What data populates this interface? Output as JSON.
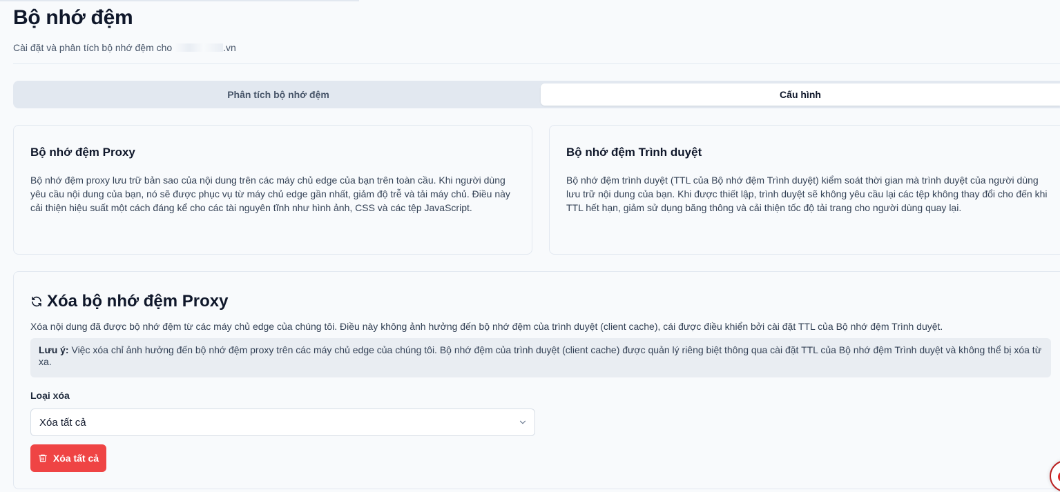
{
  "header": {
    "title": "Bộ nhớ đệm",
    "subtitle_prefix": "Cài đặt và phân tích bộ nhớ đệm cho ",
    "subtitle_domain_suffix": ".vn"
  },
  "tabs": [
    {
      "label": "Phân tích bộ nhớ đệm",
      "active": false
    },
    {
      "label": "Cấu hình",
      "active": true
    }
  ],
  "cards": {
    "proxy": {
      "title": "Bộ nhớ đệm Proxy",
      "body": "Bộ nhớ đệm proxy lưu trữ bản sao của nội dung trên các máy chủ edge của bạn trên toàn cầu. Khi người dùng yêu cầu nội dung của bạn, nó sẽ được phục vụ từ máy chủ edge gần nhất, giảm độ trễ và tải máy chủ. Điều này cải thiện hiệu suất một cách đáng kể cho các tài nguyên tĩnh như hình ảnh, CSS và các tệp JavaScript."
    },
    "browser": {
      "title": "Bộ nhớ đệm Trình duyệt",
      "body": "Bộ nhớ đệm trình duyệt (TTL của Bộ nhớ đệm Trình duyệt) kiểm soát thời gian mà trình duyệt của người dùng lưu trữ nội dung của bạn. Khi được thiết lập, trình duyệt sẽ không yêu cầu lại các tệp không thay đổi cho đến khi TTL hết hạn, giảm sử dụng băng thông và cải thiện tốc độ tải trang cho người dùng quay lại."
    }
  },
  "purge": {
    "title": "Xóa bộ nhớ đệm Proxy",
    "description": "Xóa nội dung đã được bộ nhớ đệm từ các máy chủ edge của chúng tôi. Điều này không ảnh hưởng đến bộ nhớ đệm của trình duyệt (client cache), cái được điều khiển bởi cài đặt TTL của Bộ nhớ đệm Trình duyệt.",
    "note_label": "Lưu ý:",
    "note_text": " Việc xóa chỉ ảnh hưởng đến bộ nhớ đệm proxy trên các máy chủ edge của chúng tôi. Bộ nhớ đệm của trình duyệt (client cache) được quản lý riêng biệt thông qua cài đặt TTL của Bộ nhớ đệm Trình duyệt và không thể bị xóa từ xa.",
    "type_label": "Loại xóa",
    "type_selected": "Xóa tất cả",
    "button_label": "Xóa tất cả"
  },
  "icons": {
    "refresh": "refresh-icon",
    "chevron": "chevron-down-icon",
    "trash": "trash-icon"
  },
  "colors": {
    "danger": "#ef4444",
    "tab_track": "#e2e8f0",
    "background": "#f8fafc"
  }
}
